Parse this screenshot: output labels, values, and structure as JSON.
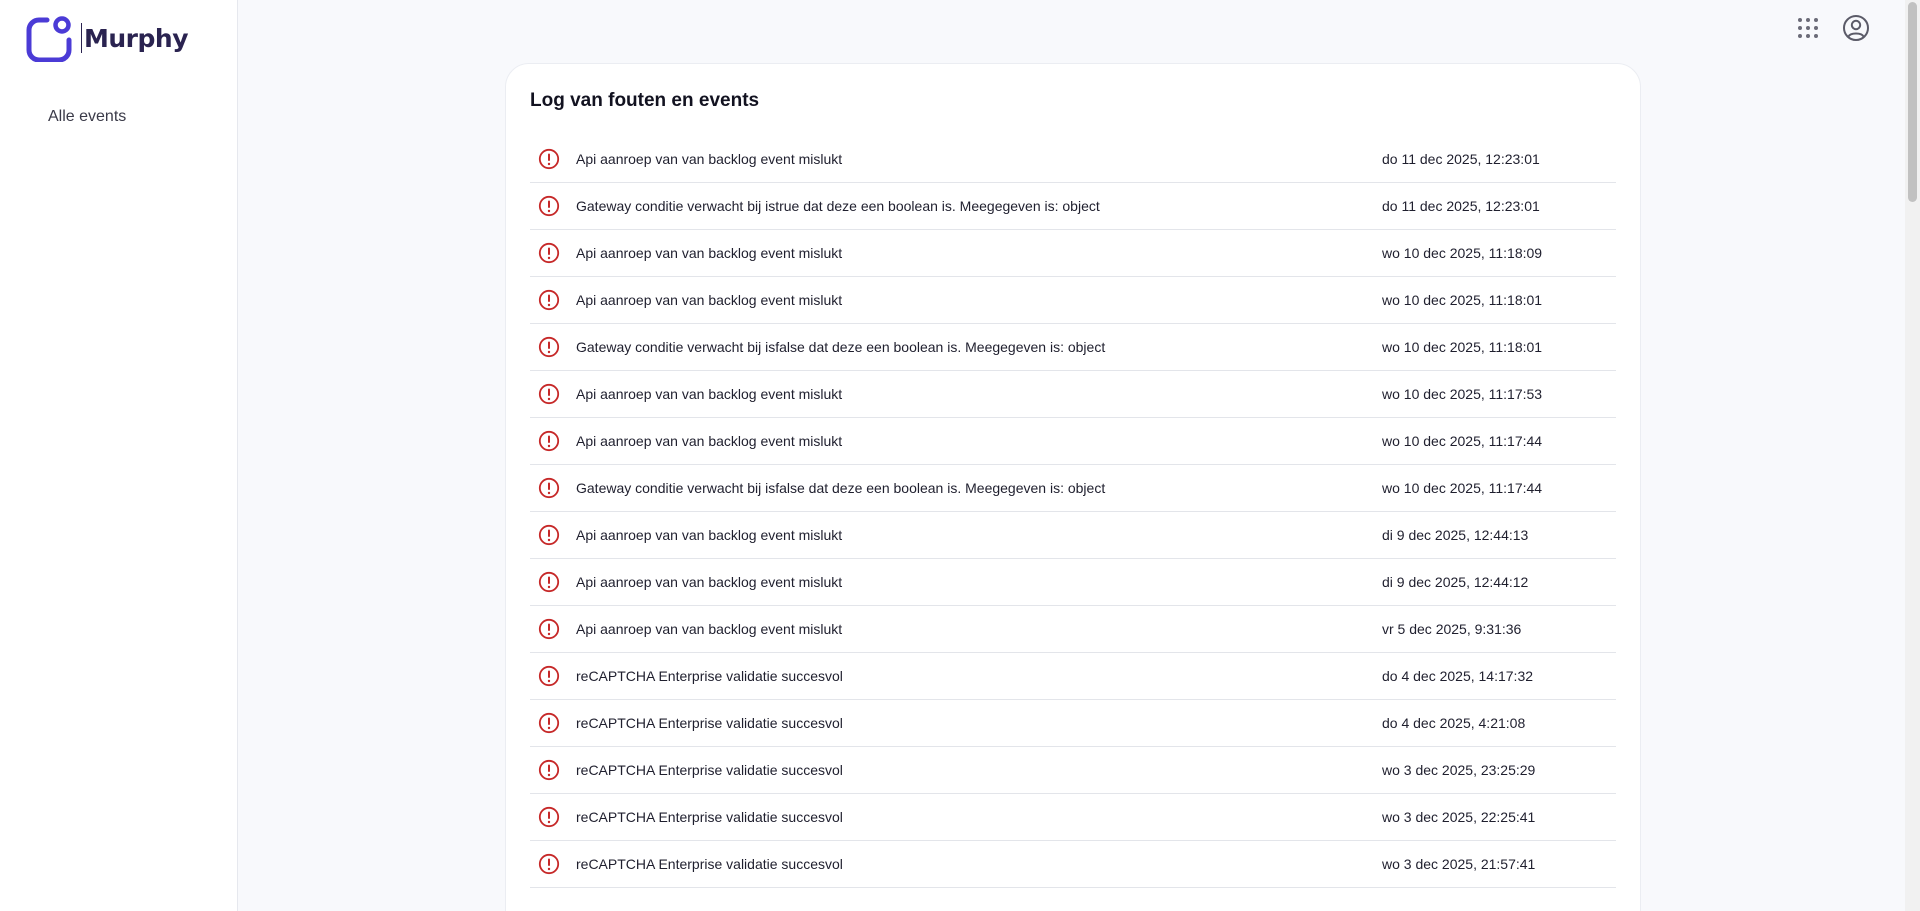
{
  "brand": {
    "name": "Murphy",
    "accent": "#4b3bd6",
    "text_color": "#2a2350"
  },
  "sidebar": {
    "items": [
      {
        "label": "Alle events"
      }
    ]
  },
  "topbar": {
    "icons": [
      "apps-grid-icon",
      "account-circle-icon"
    ]
  },
  "log": {
    "title": "Log van fouten en events",
    "error_color": "#c62828",
    "events": [
      {
        "message": "Api aanroep van van backlog event mislukt",
        "time": "do 11 dec 2025, 12:23:01"
      },
      {
        "message": "Gateway conditie verwacht bij istrue dat deze een boolean is. Meegegeven is: object",
        "time": "do 11 dec 2025, 12:23:01"
      },
      {
        "message": "Api aanroep van van backlog event mislukt",
        "time": "wo 10 dec 2025, 11:18:09"
      },
      {
        "message": "Api aanroep van van backlog event mislukt",
        "time": "wo 10 dec 2025, 11:18:01"
      },
      {
        "message": "Gateway conditie verwacht bij isfalse dat deze een boolean is. Meegegeven is: object",
        "time": "wo 10 dec 2025, 11:18:01"
      },
      {
        "message": "Api aanroep van van backlog event mislukt",
        "time": "wo 10 dec 2025, 11:17:53"
      },
      {
        "message": "Api aanroep van van backlog event mislukt",
        "time": "wo 10 dec 2025, 11:17:44"
      },
      {
        "message": "Gateway conditie verwacht bij isfalse dat deze een boolean is. Meegegeven is: object",
        "time": "wo 10 dec 2025, 11:17:44"
      },
      {
        "message": "Api aanroep van van backlog event mislukt",
        "time": "di 9 dec 2025, 12:44:13"
      },
      {
        "message": "Api aanroep van van backlog event mislukt",
        "time": "di 9 dec 2025, 12:44:12"
      },
      {
        "message": "Api aanroep van van backlog event mislukt",
        "time": "vr 5 dec 2025, 9:31:36"
      },
      {
        "message": "reCAPTCHA Enterprise validatie succesvol",
        "time": "do 4 dec 2025, 14:17:32"
      },
      {
        "message": "reCAPTCHA Enterprise validatie succesvol",
        "time": "do 4 dec 2025, 4:21:08"
      },
      {
        "message": "reCAPTCHA Enterprise validatie succesvol",
        "time": "wo 3 dec 2025, 23:25:29"
      },
      {
        "message": "reCAPTCHA Enterprise validatie succesvol",
        "time": "wo 3 dec 2025, 22:25:41"
      },
      {
        "message": "reCAPTCHA Enterprise validatie succesvol",
        "time": "wo 3 dec 2025, 21:57:41"
      }
    ]
  }
}
